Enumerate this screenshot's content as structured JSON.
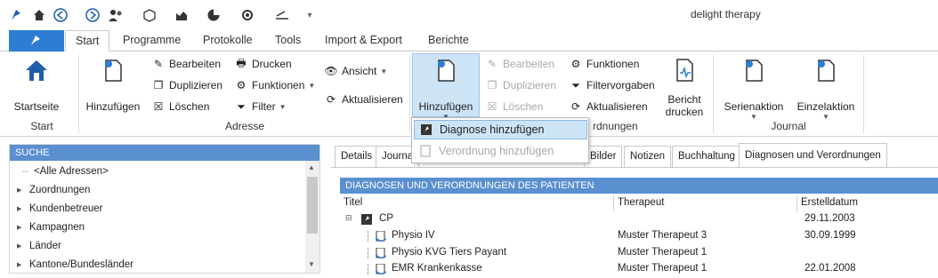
{
  "window": {
    "title": "delight therapy"
  },
  "ribbon_tabs": [
    "Start",
    "Programme",
    "Protokolle",
    "Tools",
    "Import & Export",
    "Berichte"
  ],
  "groups": {
    "start": {
      "label": "Start",
      "startseite": "Startseite"
    },
    "adresse": {
      "label": "Adresse",
      "hinzufuegen": "Hinzufügen",
      "bearbeiten": "Bearbeiten",
      "duplizieren": "Duplizieren",
      "loeschen": "Löschen",
      "drucken": "Drucken",
      "funktionen": "Funktionen",
      "filter": "Filter",
      "ansicht": "Ansicht",
      "aktualisieren": "Aktualisieren"
    },
    "verordnungen": {
      "label": "rdnungen",
      "hinzufuegen": "Hinzufügen",
      "bearbeiten": "Bearbeiten",
      "duplizieren": "Duplizieren",
      "loeschen": "Löschen",
      "funktionen": "Funktionen",
      "filtervorgaben": "Filtervorgaben",
      "aktualisieren": "Aktualisieren",
      "bericht_drucken_1": "Bericht",
      "bericht_drucken_2": "drucken"
    },
    "journal": {
      "label": "Journal",
      "serienaktion": "Serienaktion",
      "einzelaktion": "Einzelaktion"
    }
  },
  "dropdown": {
    "item1": "Diagnose hinzufügen",
    "item2": "Verordnung hinzufügen"
  },
  "left_panel": {
    "header": "SUCHE",
    "items": [
      "<Alle Adressen>",
      "Zuordnungen",
      "Kundenbetreuer",
      "Kampagnen",
      "Länder",
      "Kantone/Bundesländer"
    ]
  },
  "right_tabs": [
    "Details",
    "Journa",
    "Bilder",
    "Notizen",
    "Buchhaltung",
    "Diagnosen und Verordnungen"
  ],
  "section_header": "DIAGNOSEN UND VERORDNUNGEN DES PATIENTEN",
  "columns": {
    "titel": "Titel",
    "therapeut": "Therapeut",
    "erstelldatum": "Erstelldatum"
  },
  "rows": [
    {
      "titel": "CP",
      "therapeut": "",
      "datum": "29.11.2003"
    },
    {
      "titel": "Physio IV",
      "therapeut": "Muster Therapeut 3",
      "datum": "30.09.1999"
    },
    {
      "titel": "Physio KVG Tiers Payant",
      "therapeut": "Muster Therapeut 1",
      "datum": ""
    },
    {
      "titel": "EMR Krankenkasse",
      "therapeut": "Muster Therapeut 1",
      "datum": "22.01.2008"
    }
  ],
  "colors": {
    "accent": "#2d7dd2",
    "header_blue": "#5a8fd0",
    "highlight": "#cde4f7"
  }
}
